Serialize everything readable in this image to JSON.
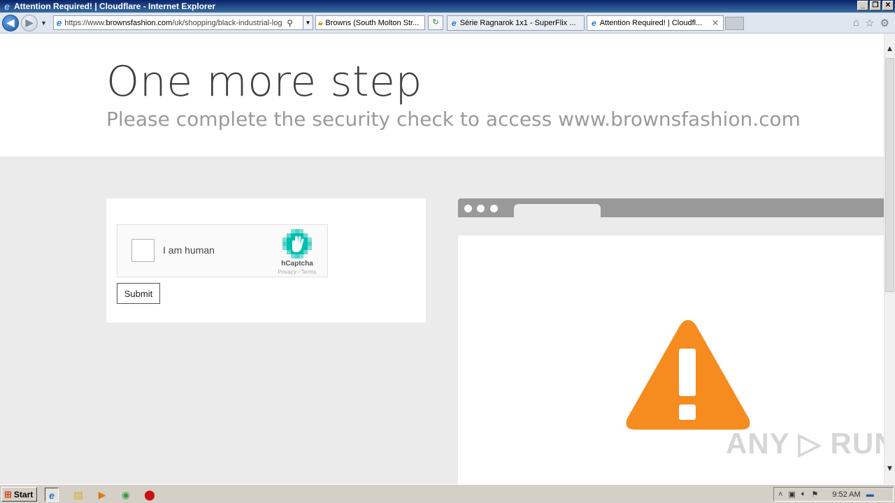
{
  "window": {
    "title": "Attention Required! | Cloudflare - Internet Explorer"
  },
  "navbar": {
    "url_prefix": "https://www.",
    "url_host": "brownsfashion.com",
    "url_path": "/uk/shopping/black-industrial-log",
    "security_label": "Browns (South Molton Str...",
    "tabs": [
      {
        "label": "Série Ragnarok 1x1 - SuperFlix ...",
        "active": false
      },
      {
        "label": "Attention Required! | Cloudfl...",
        "active": true
      }
    ]
  },
  "page": {
    "heading": "One more step",
    "subheading": "Please complete the security check to access www.brownsfashion.com",
    "captcha": {
      "label": "I am human",
      "brand": "hCaptcha",
      "links": "Privacy - Terms"
    },
    "submit_label": "Submit",
    "watermark": "ANY ▷ RUN",
    "warning_color": "#f68b1f"
  },
  "taskbar": {
    "start_label": "Start",
    "clock": "9:52 AM"
  }
}
